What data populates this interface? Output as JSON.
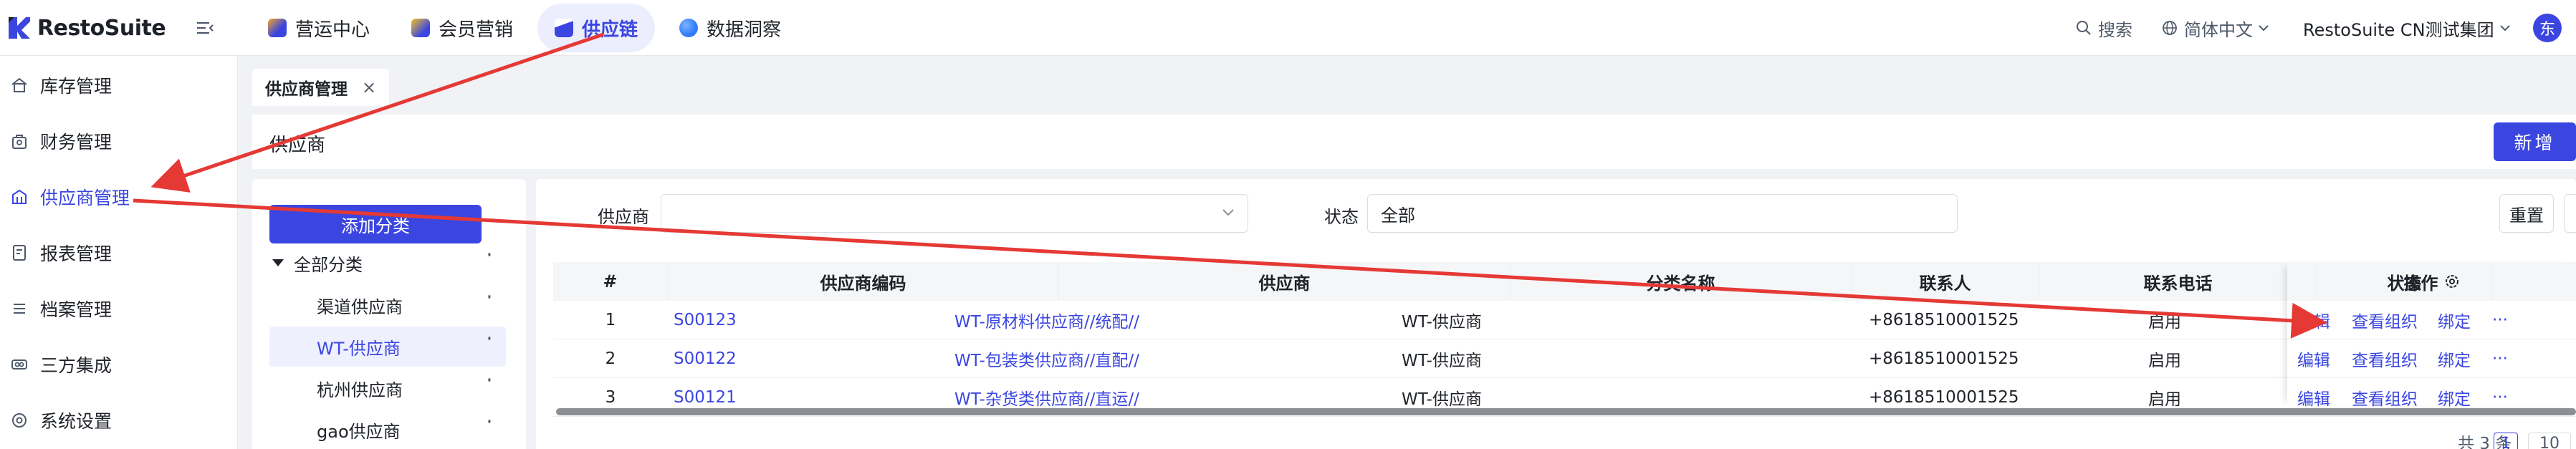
{
  "app": {
    "name": "RestoSuite"
  },
  "nav": {
    "tabs": [
      {
        "label": "营运中心",
        "color": "#3b46e0"
      },
      {
        "label": "会员营销",
        "color": "#f5a623"
      },
      {
        "label": "供应链",
        "color": "#3b46e0",
        "active": true
      },
      {
        "label": "数据洞察",
        "color": "#2f7cf6"
      }
    ]
  },
  "topright": {
    "search": "搜索",
    "language": "简体中文",
    "org": "RestoSuite CN测试集团",
    "avatar": "东"
  },
  "sidebar": {
    "items": [
      {
        "label": "库存管理",
        "icon": "home-icon"
      },
      {
        "label": "财务管理",
        "icon": "finance-icon"
      },
      {
        "label": "供应商管理",
        "icon": "supplier-icon",
        "active": true
      },
      {
        "label": "报表管理",
        "icon": "report-icon"
      },
      {
        "label": "档案管理",
        "icon": "list-icon"
      },
      {
        "label": "三方集成",
        "icon": "integration-icon"
      },
      {
        "label": "系统设置",
        "icon": "settings-icon"
      }
    ]
  },
  "page": {
    "tab_label": "供应商管理",
    "tab_close": "×",
    "title": "供应商",
    "add_button": "新增"
  },
  "tree": {
    "add_button": "添加分类",
    "root": "全部分类",
    "items": [
      {
        "label": "渠道供应商"
      },
      {
        "label": "WT-供应商",
        "active": true
      },
      {
        "label": "杭州供应商"
      },
      {
        "label": "gao供应商"
      }
    ]
  },
  "filters": {
    "supplier_label": "供应商",
    "supplier_value": "",
    "status_label": "状态",
    "status_value": "全部",
    "reset_button": "重置"
  },
  "table": {
    "columns": [
      "#",
      "供应商编码",
      "供应商",
      "分类名称",
      "联系人",
      "联系电话",
      "状态",
      "操作"
    ],
    "rows": [
      {
        "index": "1",
        "code": "S00123",
        "name": "WT-原材料供应商//统配//",
        "category": "WT-供应商",
        "contact": "",
        "phone": "+8618510001525",
        "status": "启用"
      },
      {
        "index": "2",
        "code": "S00122",
        "name": "WT-包装类供应商//直配//",
        "category": "WT-供应商",
        "contact": "",
        "phone": "+8618510001525",
        "status": "启用"
      },
      {
        "index": "3",
        "code": "S00121",
        "name": "WT-杂货类供应商//直运//",
        "category": "WT-供应商",
        "contact": "",
        "phone": "+8618510001525",
        "status": "启用"
      }
    ],
    "actions": {
      "edit": "编辑",
      "view_org": "查看组织",
      "bind": "绑定",
      "more": "···"
    }
  },
  "pagination": {
    "total": "共 3 条",
    "current": "1",
    "size": "10"
  },
  "annotation_color": "#e53935"
}
